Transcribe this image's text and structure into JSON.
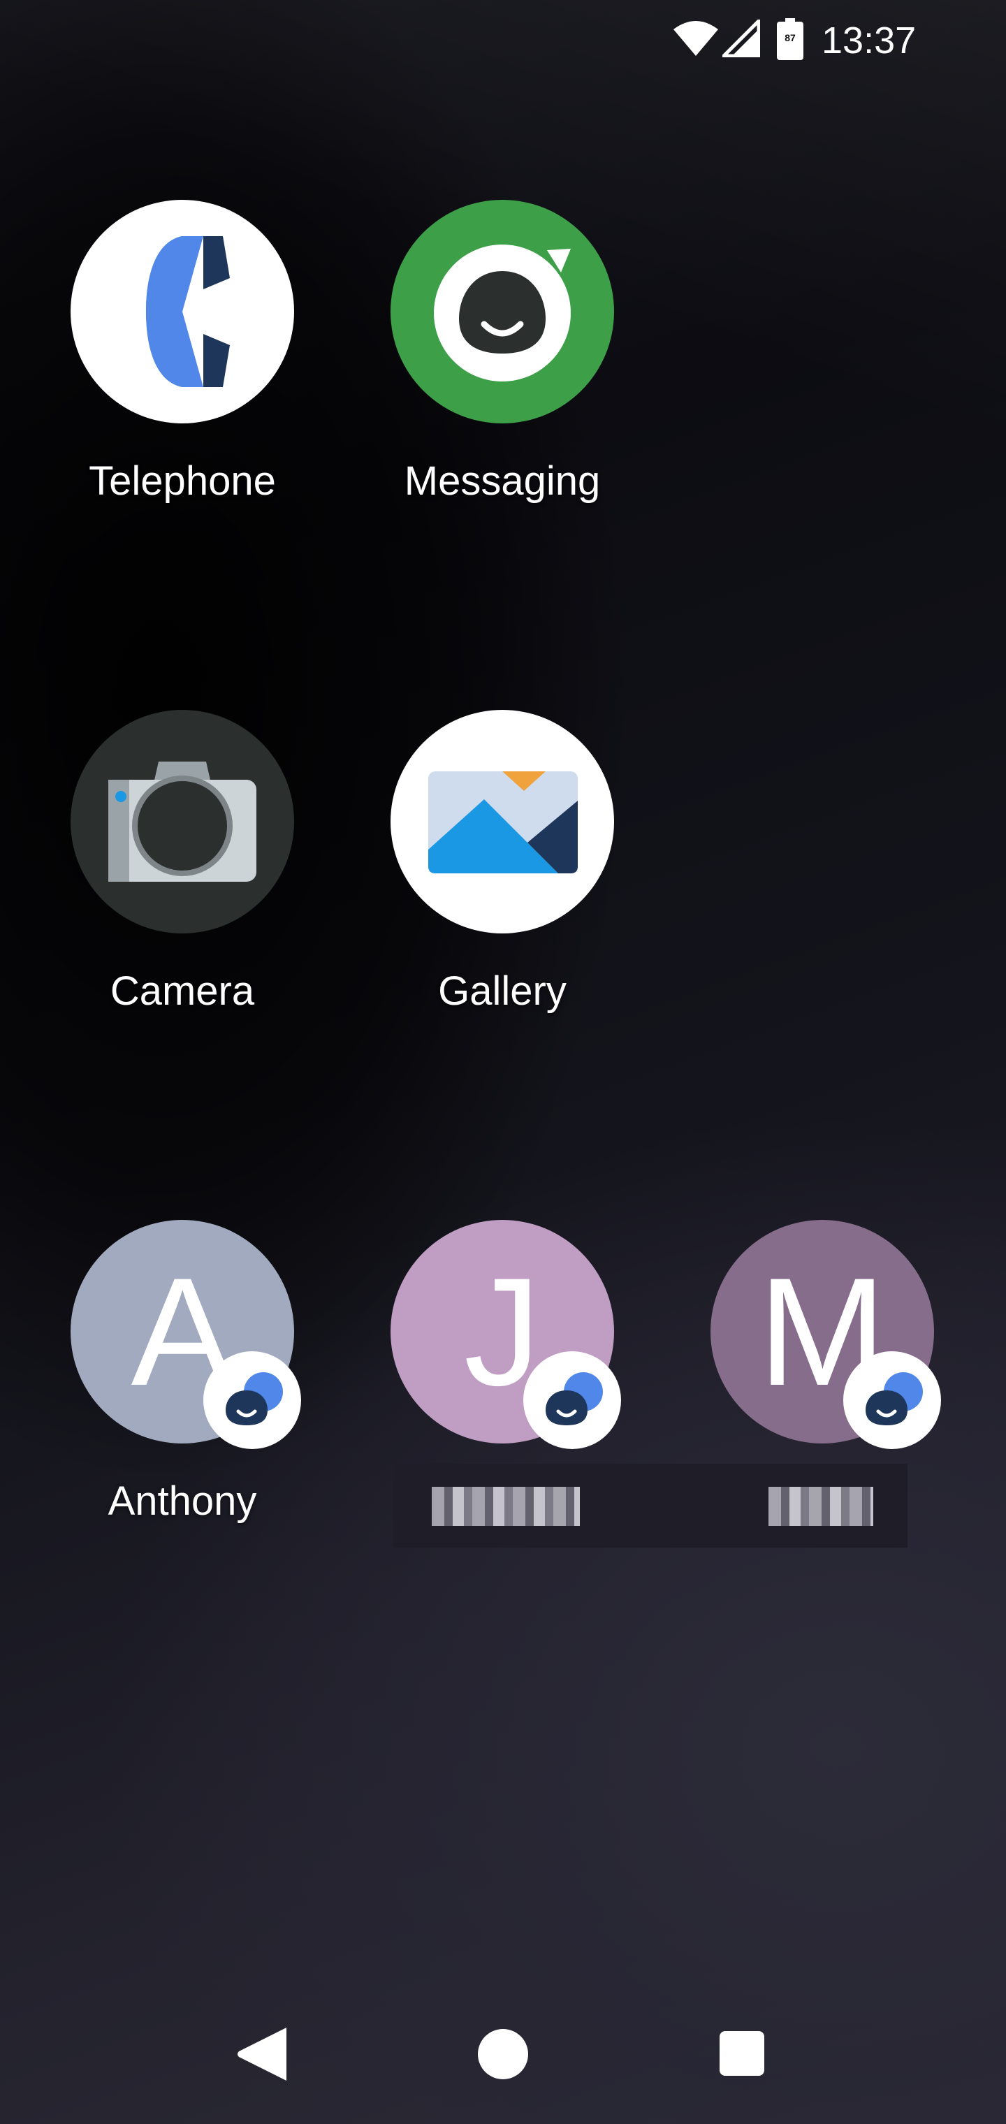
{
  "status_bar": {
    "time": "13:37",
    "battery_level": "87",
    "icons": [
      "wifi-icon",
      "cell-signal-icon",
      "battery-icon"
    ]
  },
  "apps": [
    {
      "label": "Telephone",
      "icon": "phone-icon"
    },
    {
      "label": "Messaging",
      "icon": "messaging-icon"
    },
    {
      "label": "Camera",
      "icon": "camera-icon"
    },
    {
      "label": "Gallery",
      "icon": "gallery-icon"
    }
  ],
  "contacts": [
    {
      "label": "Anthony",
      "initial": "A",
      "color": "#a2aabf",
      "badge": "messaging-badge-icon"
    },
    {
      "label": "",
      "initial": "J",
      "color": "#c09dc3",
      "badge": "messaging-badge-icon"
    },
    {
      "label": "",
      "initial": "M",
      "color": "#866d8c",
      "badge": "messaging-badge-icon"
    }
  ],
  "colors": {
    "phone_blue": "#5087e8",
    "phone_navy": "#1e3659",
    "messaging_green": "#3da049",
    "camera_dark": "#2b302f",
    "gallery_blue": "#1a98e3",
    "gallery_orange": "#f0a23c"
  },
  "nav_bar": {
    "buttons": [
      "back-button",
      "home-button",
      "recents-button"
    ]
  }
}
